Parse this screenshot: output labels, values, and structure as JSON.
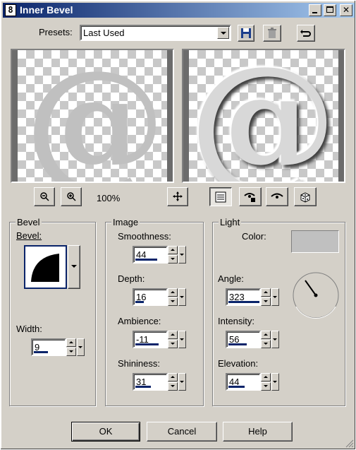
{
  "window": {
    "title": "Inner Bevel",
    "app_icon": "8"
  },
  "presets": {
    "label": "Presets:",
    "value": "Last Used"
  },
  "zoom": {
    "level": "100%"
  },
  "bevel": {
    "group_label": "Bevel",
    "bevel_label": "Bevel:",
    "width_label": "Width:",
    "width_value": "9"
  },
  "image": {
    "group_label": "Image",
    "smoothness_label": "Smoothness:",
    "smoothness_value": "44",
    "depth_label": "Depth:",
    "depth_value": "16",
    "ambience_label": "Ambience:",
    "ambience_value": "-11",
    "shininess_label": "Shininess:",
    "shininess_value": "31"
  },
  "light": {
    "group_label": "Light",
    "color_label": "Color:",
    "color_swatch": "#c0c0c0",
    "angle_label": "Angle:",
    "angle_value": "323",
    "intensity_label": "Intensity:",
    "intensity_value": "56",
    "elevation_label": "Elevation:",
    "elevation_value": "44"
  },
  "preview": {
    "glyph": "@"
  },
  "buttons": {
    "ok": "OK",
    "cancel": "Cancel",
    "help": "Help"
  },
  "colors": {
    "titlebar_start": "#0a246a",
    "titlebar_end": "#a6caf0",
    "dialog_bg": "#d4d0c8"
  }
}
